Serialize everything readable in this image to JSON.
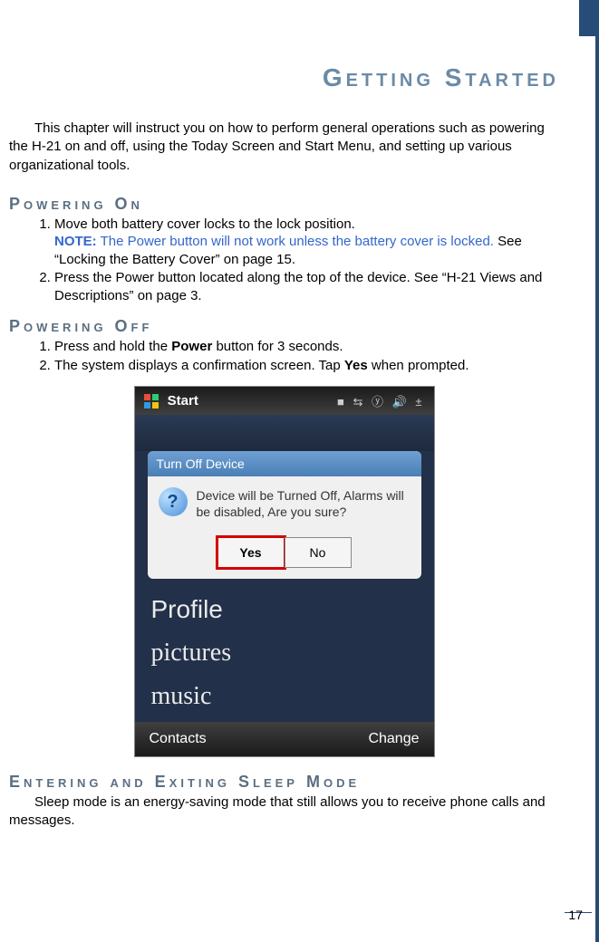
{
  "chapter_title": "Getting Started",
  "intro": "This chapter will instruct you on how to perform general operations such as powering the H-21 on and off, using the Today Screen and Start Menu, and setting up various organizational tools.",
  "section_power_on": {
    "title": "Powering On",
    "items": [
      "Move both battery cover locks to the lock position.",
      "Press the Power button located along the top of the device. See “H-21 Views and Descriptions” on page 3."
    ],
    "note_label": "NOTE:",
    "note_blue": "The Power button will not work unless the battery cover is locked.",
    "note_rest": "See “Locking the Battery Cover” on page 15."
  },
  "section_power_off": {
    "title": "Powering Off",
    "item1_pre": "Press and hold the ",
    "item1_bold": "Power",
    "item1_post": " button for 3 seconds.",
    "item2_pre": "The system displays a confirmation screen. Tap ",
    "item2_bold": "Yes",
    "item2_post": " when prompted."
  },
  "screenshot": {
    "start_label": "Start",
    "status_icons": "■ ⇆ ⓨ 🔊 ±",
    "dialog_title": "Turn Off Device",
    "dialog_message": "Device will be Turned Off, Alarms will be disabled, Are you sure?",
    "yes": "Yes",
    "no": "No",
    "tiles": [
      "Profile",
      "pictures",
      "music"
    ],
    "softkey_left": "Contacts",
    "softkey_right": "Change"
  },
  "section_sleep": {
    "title": "Entering and Exiting Sleep Mode",
    "text": "Sleep mode is an energy-saving mode that still allows you to receive phone calls and messages."
  },
  "page_number": "17"
}
